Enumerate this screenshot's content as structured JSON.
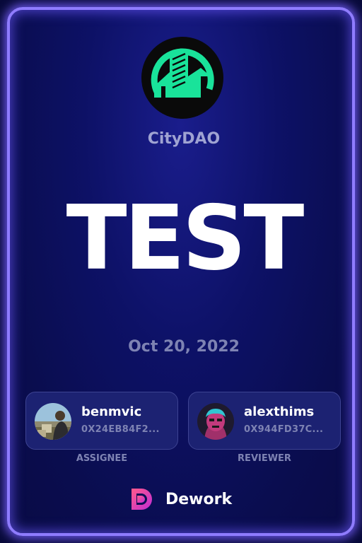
{
  "organization": {
    "name": "CityDAO",
    "logo_icon": "citydao-building-logo-icon",
    "logo_color": "#19e39a"
  },
  "task": {
    "title": "TEST",
    "date": "Oct 20, 2022"
  },
  "assignee": {
    "username": "benmvic",
    "address": "0X24EB84F2...",
    "role_label": "ASSIGNEE",
    "avatar_icon": "user-photo-avatar"
  },
  "reviewer": {
    "username": "alexthims",
    "address": "0X944FD37C...",
    "role_label": "REVIEWER",
    "avatar_icon": "user-illustrated-avatar"
  },
  "brand": {
    "name": "Dework",
    "icon": "dework-logo-icon"
  },
  "colors": {
    "card_background": "#0d1166",
    "border_glow": "#8f7cff",
    "muted_text": "#7e83b3"
  }
}
